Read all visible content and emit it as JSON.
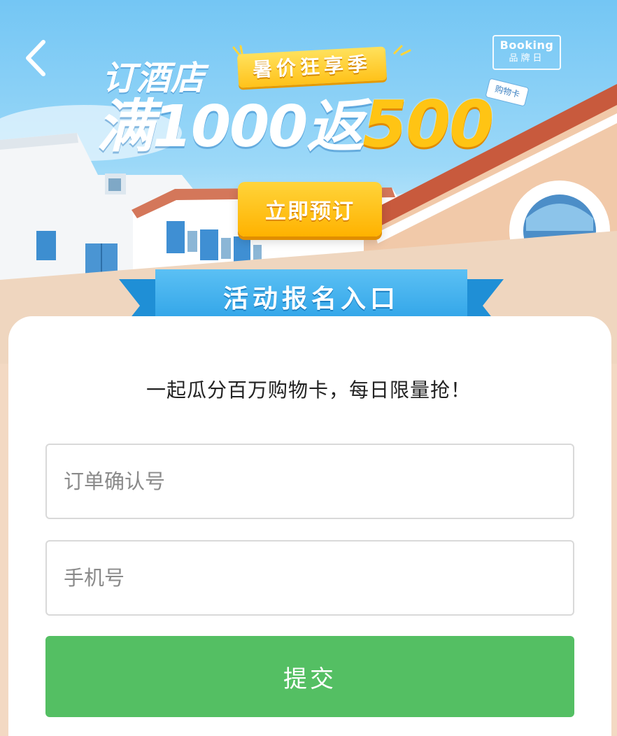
{
  "header": {
    "back_icon": "chevron-left-icon",
    "brand_badge": {
      "line1": "Booking",
      "line2": "品牌日"
    }
  },
  "hero": {
    "line1": "订酒店",
    "tag": "暑价狂享季",
    "line2_prefix": "满1000返",
    "line2_amount": "500",
    "price_tag": "购物卡",
    "cta_label": "立即预订"
  },
  "form": {
    "ribbon_title": "活动报名入口",
    "slogan": "一起瓜分百万购物卡，每日限量抢！",
    "order_placeholder": "订单确认号",
    "phone_placeholder": "手机号",
    "submit_label": "提交"
  },
  "colors": {
    "sky": "#74c6f4",
    "accent_gold": "#ffc414",
    "ribbon_blue": "#2aa0e6",
    "submit_green": "#54bf63",
    "wall_peach": "#f3d9c3"
  }
}
